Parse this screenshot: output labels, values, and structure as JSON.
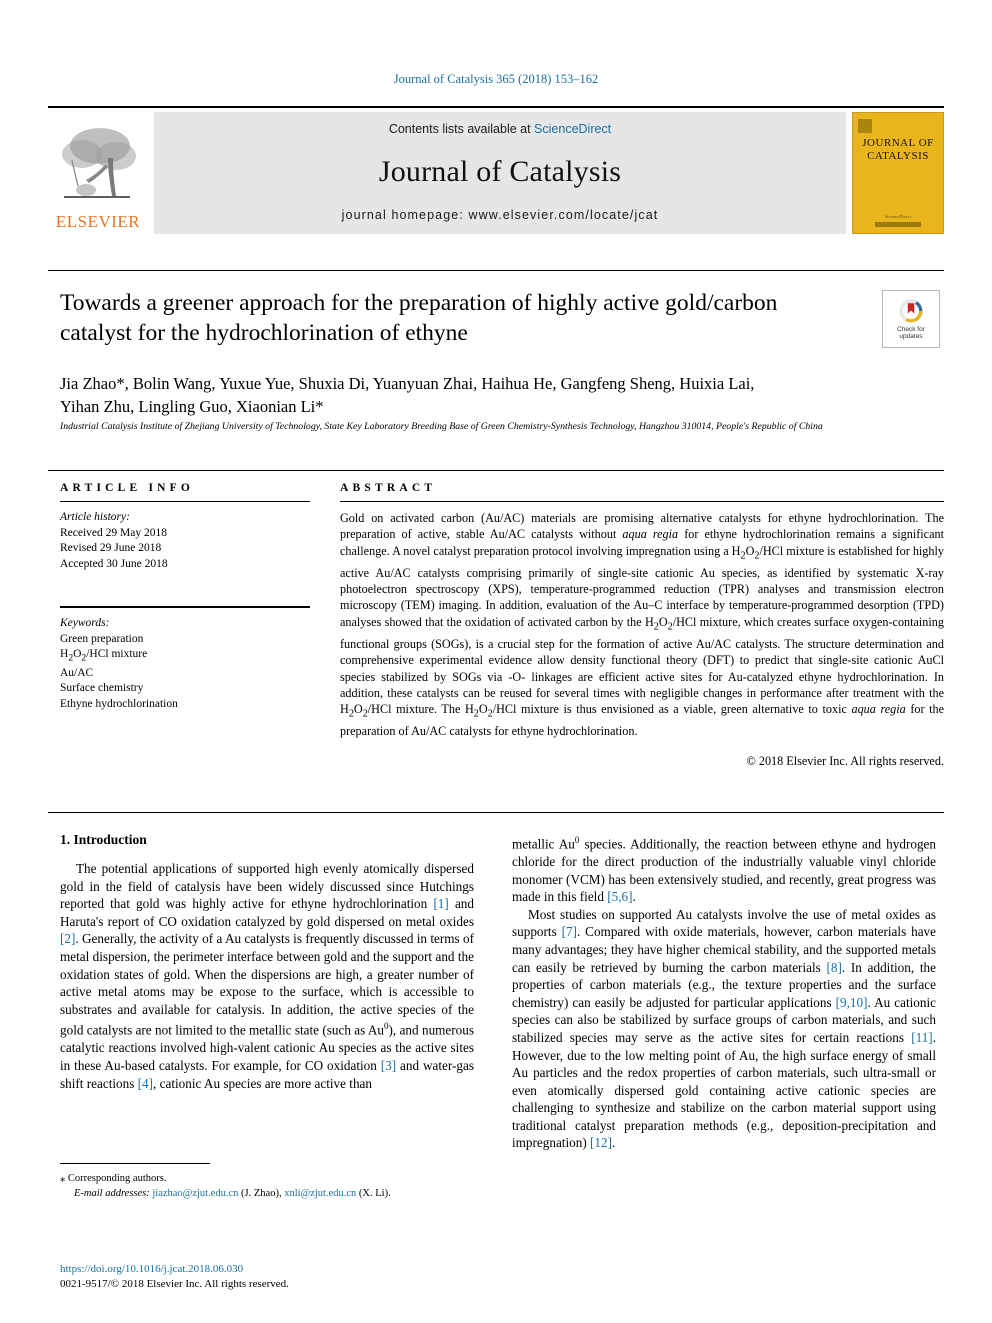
{
  "running_head": "Journal of Catalysis 365 (2018) 153–162",
  "masthead": {
    "publisher_name": "ELSEVIER",
    "contents_prefix": "Contents lists available at ",
    "contents_link": "ScienceDirect",
    "journal_title": "Journal of Catalysis",
    "homepage": "journal homepage: www.elsevier.com/locate/jcat",
    "cover_title_line1": "JOURNAL OF",
    "cover_title_line2": "CATALYSIS",
    "cover_footer": "ScienceDirect"
  },
  "article": {
    "title": "Towards a greener approach for the preparation of highly active gold/carbon catalyst for the hydrochlorination of ethyne",
    "authors_line1": "Jia Zhao*, Bolin Wang, Yuxue Yue, Shuxia Di, Yuanyuan Zhai, Haihua He, Gangfeng Sheng, Huixia Lai,",
    "authors_line2": "Yihan Zhu, Lingling Guo, Xiaonian Li*",
    "affiliation": "Industrial Catalysis Institute of Zhejiang University of Technology, State Key Laboratory Breeding Base of Green Chemistry-Synthesis Technology, Hangzhou 310014, People's Republic of China",
    "crossmark_label_line1": "Check for",
    "crossmark_label_line2": "updates"
  },
  "article_info": {
    "heading": "ARTICLE INFO",
    "history_label": "Article history:",
    "history": [
      "Received 29 May 2018",
      "Revised 29 June 2018",
      "Accepted 30 June 2018"
    ],
    "keywords_label": "Keywords:",
    "keywords": [
      "Green preparation",
      "H2O2/HCl mixture",
      "Au/AC",
      "Surface chemistry",
      "Ethyne hydrochlorination"
    ]
  },
  "abstract": {
    "heading": "ABSTRACT",
    "text": "Gold on activated carbon (Au/AC) materials are promising alternative catalysts for ethyne hydrochlorination. The preparation of active, stable Au/AC catalysts without aqua regia for ethyne hydrochlorination remains a significant challenge. A novel catalyst preparation protocol involving impregnation using a H2O2/HCl mixture is established for highly active Au/AC catalysts comprising primarily of single-site cationic Au species, as identified by systematic X-ray photoelectron spectroscopy (XPS), temperature-programmed reduction (TPR) analyses and transmission electron microscopy (TEM) imaging. In addition, evaluation of the Au–C interface by temperature-programmed desorption (TPD) analyses showed that the oxidation of activated carbon by the H2O2/HCl mixture, which creates surface oxygen-containing functional groups (SOGs), is a crucial step for the formation of active Au/AC catalysts. The structure determination and comprehensive experimental evidence allow density functional theory (DFT) to predict that single-site cationic AuCl species stabilized by SOGs via -O- linkages are efficient active sites for Au-catalyzed ethyne hydrochlorination. In addition, these catalysts can be reused for several times with negligible changes in performance after treatment with the H2O2/HCl mixture. The H2O2/HCl mixture is thus envisioned as a viable, green alternative to toxic aqua regia for the preparation of Au/AC catalysts for ethyne hydrochlorination.",
    "copyright": "© 2018 Elsevier Inc. All rights reserved."
  },
  "introduction": {
    "heading": "1. Introduction",
    "para1": "The potential applications of supported high evenly atomically dispersed gold in the field of catalysis have been widely discussed since Hutchings reported that gold was highly active for ethyne hydrochlorination [1] and Haruta's report of CO oxidation catalyzed by gold dispersed on metal oxides [2]. Generally, the activity of a Au catalysts is frequently discussed in terms of metal dispersion, the perimeter interface between gold and the support and the oxidation states of gold. When the dispersions are high, a greater number of active metal atoms may be expose to the surface, which is accessible to substrates and available for catalysis. In addition, the active species of the gold catalysts are not limited to the metallic state (such as Au0), and numerous catalytic reactions involved high-valent cationic Au species as the active sites in these Au-based catalysts. For example, for CO oxidation [3] and water-gas shift reactions [4], cationic Au species are more active than metallic Au0 species. Additionally, the reaction between ethyne and hydrogen chloride for the direct production of the industrially valuable vinyl chloride monomer (VCM) has been extensively studied, and recently, great progress was made in this field [5,6].",
    "para2": "Most studies on supported Au catalysts involve the use of metal oxides as supports [7]. Compared with oxide materials, however, carbon materials have many advantages; they have higher chemical stability, and the supported metals can easily be retrieved by burning the carbon materials [8]. In addition, the properties of carbon materials (e.g., the texture properties and the surface chemistry) can easily be adjusted for particular applications [9,10]. Au cationic species can also be stabilized by surface groups of carbon materials, and such stabilized species may serve as the active sites for certain reactions [11]. However, due to the low melting point of Au, the high surface energy of small Au particles and the redox properties of carbon materials, such ultra-small or even atomically dispersed gold containing active cationic species are challenging to synthesize and stabilize on the carbon material support using traditional catalyst preparation methods (e.g., deposition-precipitation and impregnation) [12]."
  },
  "footer": {
    "corresponding_marker": "⁎",
    "corresponding_text": "Corresponding authors.",
    "email_label": "E-mail addresses:",
    "email1": "jiazhao@zjut.edu.cn",
    "email1_owner": "(J. Zhao),",
    "email2": "xnli@zjut.edu.cn",
    "email2_owner": "(X. Li).",
    "doi": "https://doi.org/10.1016/j.jcat.2018.06.030",
    "issn_line": "0021-9517/© 2018 Elsevier Inc. All rights reserved."
  },
  "colors": {
    "link": "#1c6ea4",
    "elsevier_orange": "#E87722",
    "cover_yellow": "#E8B51C",
    "band_gray": "#e6e6e6"
  }
}
